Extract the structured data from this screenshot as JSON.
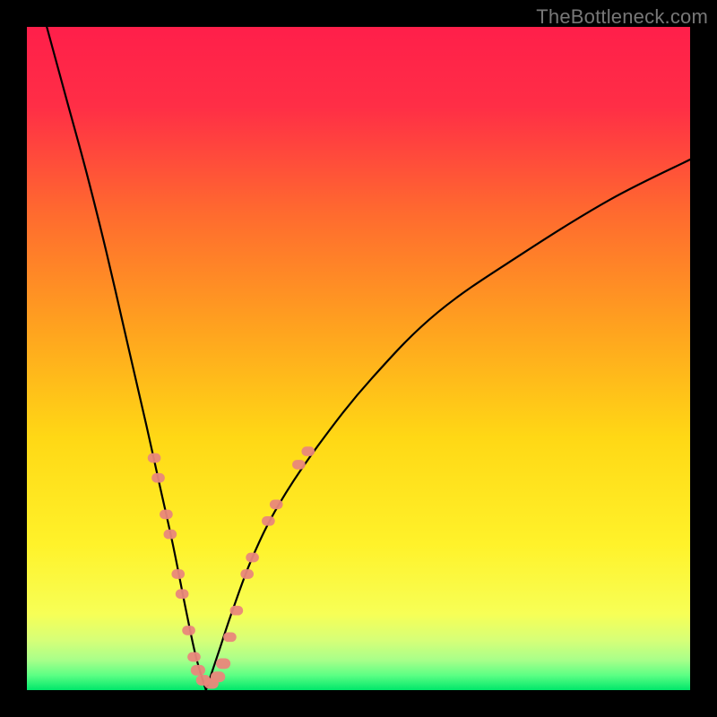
{
  "watermark": "TheBottleneck.com",
  "chart_data": {
    "type": "line",
    "title": "",
    "xlabel": "",
    "ylabel": "",
    "xlim": [
      0,
      100
    ],
    "ylim": [
      0,
      100
    ],
    "description": "V-shaped bottleneck curve over red-yellow-green gradient; minimum around x≈27 at y≈0 (green zone). Left branch steep, right branch shallow. Salmon dot clusters near the trough and on both branch sides in the yellow band.",
    "series": [
      {
        "name": "left-curve",
        "x": [
          3,
          6,
          9,
          12,
          15,
          18,
          20,
          22,
          24,
          25.5,
          27
        ],
        "y": [
          100,
          89,
          78,
          66,
          53,
          40,
          31,
          22,
          12,
          5,
          0
        ]
      },
      {
        "name": "right-curve",
        "x": [
          27,
          29,
          31,
          34,
          38,
          44,
          52,
          62,
          75,
          88,
          100
        ],
        "y": [
          0,
          6,
          12,
          20,
          28,
          37,
          47,
          57,
          66,
          74,
          80
        ]
      }
    ],
    "markers": [
      {
        "x": 19.2,
        "y": 35.0,
        "r": 0.9
      },
      {
        "x": 19.8,
        "y": 32.0,
        "r": 0.9
      },
      {
        "x": 21.0,
        "y": 26.5,
        "r": 0.9
      },
      {
        "x": 21.6,
        "y": 23.5,
        "r": 0.9
      },
      {
        "x": 22.8,
        "y": 17.5,
        "r": 0.9
      },
      {
        "x": 23.4,
        "y": 14.5,
        "r": 0.9
      },
      {
        "x": 24.4,
        "y": 9.0,
        "r": 0.9
      },
      {
        "x": 25.2,
        "y": 5.0,
        "r": 0.9
      },
      {
        "x": 25.8,
        "y": 3.0,
        "r": 1.0
      },
      {
        "x": 26.6,
        "y": 1.5,
        "r": 1.0
      },
      {
        "x": 27.8,
        "y": 1.0,
        "r": 1.0
      },
      {
        "x": 28.8,
        "y": 2.0,
        "r": 1.0
      },
      {
        "x": 29.6,
        "y": 4.0,
        "r": 1.0
      },
      {
        "x": 30.6,
        "y": 8.0,
        "r": 0.9
      },
      {
        "x": 31.6,
        "y": 12.0,
        "r": 0.9
      },
      {
        "x": 33.2,
        "y": 17.5,
        "r": 0.9
      },
      {
        "x": 34.0,
        "y": 20.0,
        "r": 0.9
      },
      {
        "x": 36.4,
        "y": 25.5,
        "r": 0.9
      },
      {
        "x": 37.6,
        "y": 28.0,
        "r": 0.9
      },
      {
        "x": 41.0,
        "y": 34.0,
        "r": 0.9
      },
      {
        "x": 42.4,
        "y": 36.0,
        "r": 0.9
      }
    ],
    "gradient_stops": [
      {
        "offset": 0.0,
        "color": "#ff1f4a"
      },
      {
        "offset": 0.12,
        "color": "#ff2e46"
      },
      {
        "offset": 0.28,
        "color": "#ff6a2f"
      },
      {
        "offset": 0.45,
        "color": "#ffa11f"
      },
      {
        "offset": 0.62,
        "color": "#ffd815"
      },
      {
        "offset": 0.78,
        "color": "#fff22a"
      },
      {
        "offset": 0.885,
        "color": "#f7ff56"
      },
      {
        "offset": 0.925,
        "color": "#d6ff78"
      },
      {
        "offset": 0.955,
        "color": "#a8ff8a"
      },
      {
        "offset": 0.978,
        "color": "#5bff84"
      },
      {
        "offset": 1.0,
        "color": "#00e66a"
      }
    ],
    "curve_color": "#000000",
    "marker_color": "#e9877b"
  }
}
